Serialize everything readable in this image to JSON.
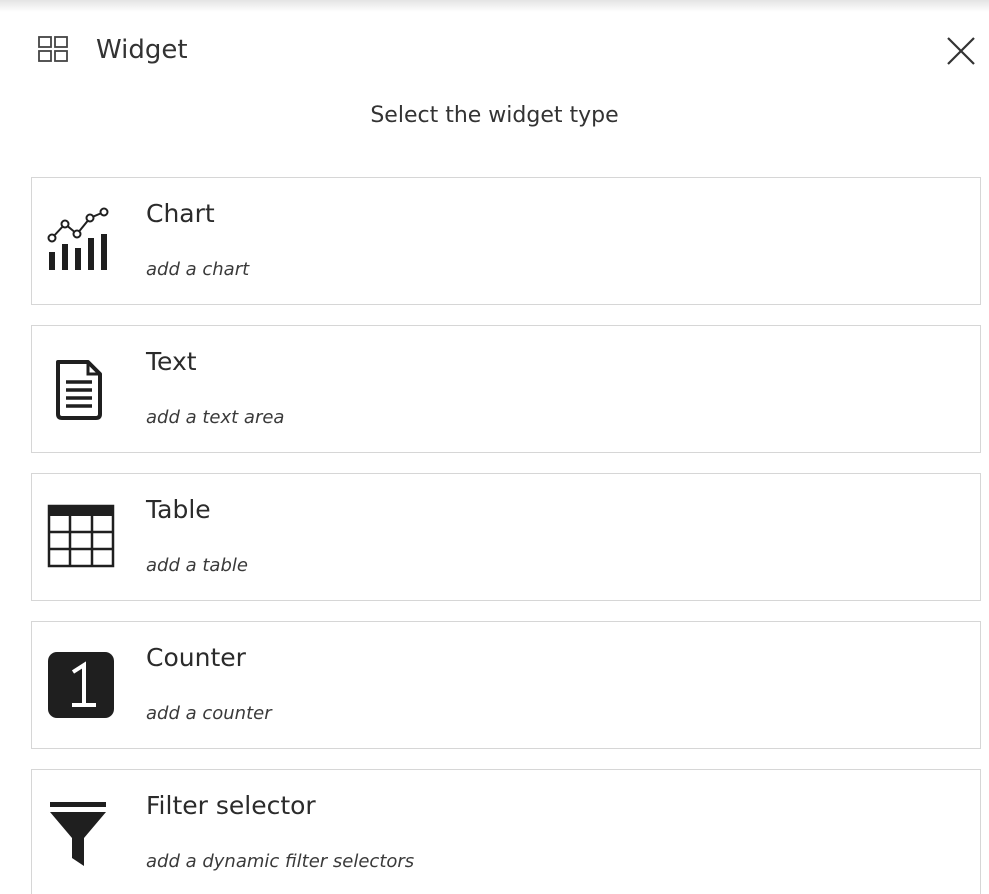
{
  "header": {
    "title": "Widget",
    "icon": "widget-grid-icon",
    "close_icon": "close-icon"
  },
  "subtitle": "Select the widget type",
  "widgets": [
    {
      "title": "Chart",
      "description": "add a chart",
      "icon": "chart-icon"
    },
    {
      "title": "Text",
      "description": "add a text area",
      "icon": "text-document-icon"
    },
    {
      "title": "Table",
      "description": "add a table",
      "icon": "table-icon"
    },
    {
      "title": "Counter",
      "description": "add a counter",
      "icon": "counter-icon"
    },
    {
      "title": "Filter selector",
      "description": "add a dynamic filter selectors",
      "icon": "filter-icon"
    }
  ],
  "colors": {
    "text": "#2b2b2b",
    "border": "#d6d6d6",
    "icon": "#1f1f1f"
  }
}
